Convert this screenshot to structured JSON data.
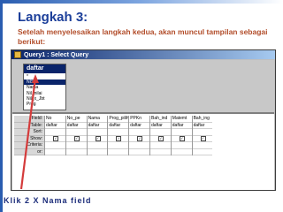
{
  "slide": {
    "heading": "Langkah 3:",
    "subtext": "Setelah menyelesaikan langkah kedua, akan muncul tampilan sebagai berikut:",
    "caption": "Klik 2 X Nama field"
  },
  "window": {
    "title": "Query1 : Select Query",
    "table": {
      "name": "daftar",
      "fields": [
        "*",
        "NIS",
        "Nama",
        "Nil_nilai",
        "Nil_x_Jbt",
        "Prog"
      ]
    }
  },
  "grid": {
    "row_labels": [
      "Field:",
      "Table:",
      "Sort:",
      "Show:",
      "Criteria:",
      "or:"
    ],
    "columns": [
      {
        "field": "No",
        "table": "daftar"
      },
      {
        "field": "No_pe",
        "table": "daftar"
      },
      {
        "field": "Nama",
        "table": "daftar"
      },
      {
        "field": "Prog_pilihan",
        "table": "daftar"
      },
      {
        "field": "PPKn",
        "table": "daftar"
      },
      {
        "field": "Bah_ind",
        "table": "daftar"
      },
      {
        "field": "Matemt",
        "table": "daftar"
      },
      {
        "field": "Bah_ing",
        "table": "daftar"
      }
    ]
  },
  "colors": {
    "heading": "#1c3f9a",
    "subtext": "#b24d2a",
    "arrow": "#d43b3b"
  }
}
